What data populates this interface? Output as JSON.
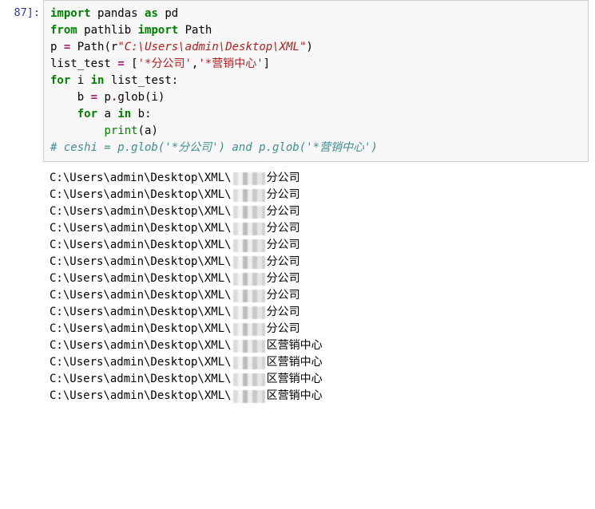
{
  "cell": {
    "prompt": "87]:",
    "code": {
      "l1": {
        "import": "import",
        "mod1": "pandas",
        "as": "as",
        "alias": "pd"
      },
      "l2": {
        "from": "from",
        "mod": "pathlib",
        "import": "import",
        "cls": "Path"
      },
      "l3": {
        "var": "p",
        "eq": "=",
        "call": "Path",
        "open": "(",
        "r": "r",
        "q1": "\"",
        "path": "C:\\Users\\admin\\Desktop\\XML",
        "q2": "\"",
        "close": ")"
      },
      "l4": {
        "var": "list_test",
        "eq": "=",
        "open": "[",
        "s1": "'*分公司'",
        "comma": ",",
        "s2": "'*营销中心'",
        "close": "]"
      },
      "l5": {
        "for": "for",
        "i": "i",
        "in": "in",
        "seq": "list_test",
        "colon": ":"
      },
      "l6": {
        "var": "b",
        "eq": "=",
        "obj": "p",
        "dot": ".",
        "method": "glob",
        "open": "(",
        "arg": "i",
        "close": ")"
      },
      "l7": {
        "for": "for",
        "a": "a",
        "in": "in",
        "seq": "b",
        "colon": ":"
      },
      "l8": {
        "print": "print",
        "open": "(",
        "arg": "a",
        "close": ")"
      },
      "l9": {
        "comment": "# ceshi = p.glob('*分公司') and p.glob('*营销中心')"
      }
    }
  },
  "output": {
    "prefix": "C:\\Users\\admin\\Desktop\\XML\\",
    "suffix_branch": "分公司",
    "suffix_center": "区营销中心",
    "lines": [
      {
        "s": "branch"
      },
      {
        "s": "branch"
      },
      {
        "s": "branch"
      },
      {
        "s": "branch"
      },
      {
        "s": "branch"
      },
      {
        "s": "branch"
      },
      {
        "s": "branch"
      },
      {
        "s": "branch"
      },
      {
        "s": "branch"
      },
      {
        "s": "branch"
      },
      {
        "s": "center"
      },
      {
        "s": "center"
      },
      {
        "s": "center"
      },
      {
        "s": "center"
      }
    ]
  }
}
